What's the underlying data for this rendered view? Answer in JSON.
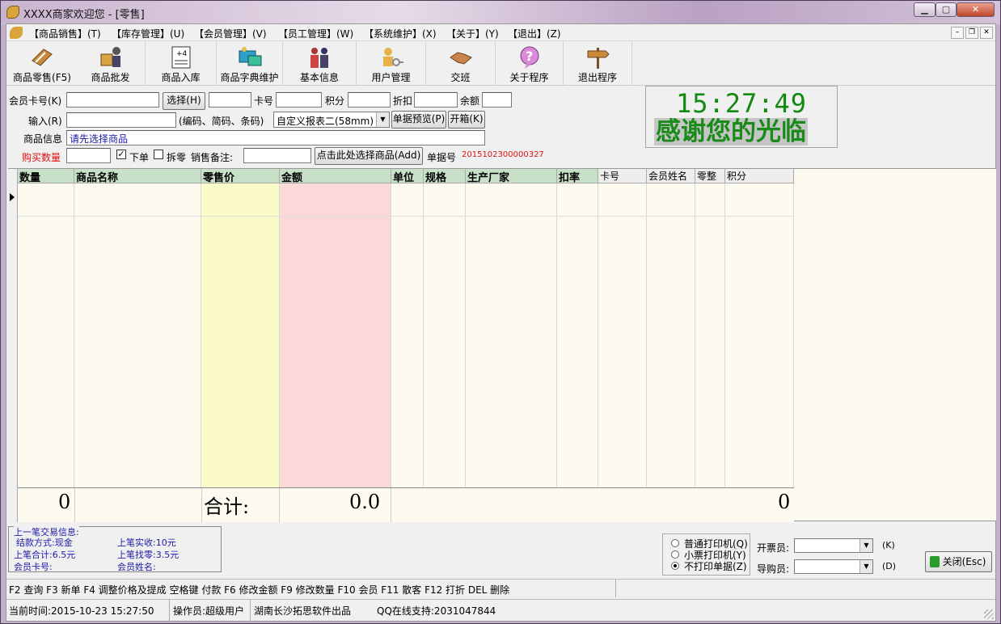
{
  "window": {
    "title": "XXXX商家欢迎您 - [零售]"
  },
  "menu": [
    "【商品销售】(T)",
    "【库存管理】(U)",
    "【会员管理】(V)",
    "【员工管理】(W)",
    "【系统维护】(X)",
    "【关于】(Y)",
    "【退出】(Z)"
  ],
  "toolbar": [
    "商品零售(F5)",
    "商品批发",
    "商品入库",
    "商品字典维护",
    "基本信息",
    "用户管理",
    "交班",
    "关于程序",
    "退出程序"
  ],
  "form": {
    "member_card_label": "会员卡号(K)",
    "select_button": "选择(H)",
    "card_label": "卡号",
    "points_label": "积分",
    "discount_label": "折扣",
    "balance_label": "余额",
    "input_label": "输入(R)",
    "input_hint": "(编码、简码、条码)",
    "report_select": "自定义报表二(58mm)",
    "preview_button": "单据预览(P)",
    "open_box_button": "开箱(K)",
    "goods_info_label": "商品信息",
    "goods_info_value": "请先选择商品",
    "qty_label": "购买数量",
    "order_check_label": "下单",
    "order_checked": true,
    "split_label": "拆零",
    "split_checked": false,
    "remark_label": "销售备注:",
    "choose_goods_button": "点击此处选择商品(Add)",
    "bill_no_label": "单据号",
    "bill_no": "2015102300000327"
  },
  "clock": {
    "time": "15:27:49",
    "message": "感谢您的光临"
  },
  "grid": {
    "columns": [
      "数量",
      "商品名称",
      "零售价",
      "金额",
      "单位",
      "规格",
      "生产厂家",
      "扣率",
      "卡号",
      "会员姓名",
      "零整",
      "积分"
    ],
    "totals": {
      "qty": "0",
      "label": "合计:",
      "amount": "0.0",
      "points": "0"
    }
  },
  "last_trade": {
    "title": "上一笔交易信息:",
    "pay_method": "结款方式:现金",
    "last_total": "上笔合计:6.5元",
    "member_card": "会员卡号:",
    "received": "上笔实收:10元",
    "change": "上笔找零:3.5元",
    "member_name": "会员姓名:"
  },
  "print": {
    "options": [
      "普通打印机(Q)",
      "小票打印机(Y)",
      "不打印单据(Z)"
    ],
    "selected": 2
  },
  "staff": {
    "invoice_label": "开票员:",
    "invoice_key": "(K)",
    "guide_label": "导购员:",
    "guide_key": "(D)",
    "close_button": "关闭(Esc)"
  },
  "shortcuts": "F2 查询 F3 新单 F4 调整价格及提成 空格键 付款 F6 修改金额  F9 修改数量 F10 会员 F11 散客 F12 打折 DEL 删除",
  "status": {
    "time": "当前时间:2015-10-23 15:27:50",
    "operator": "操作员:超级用户",
    "vendor": "湖南长沙拓思软件出品",
    "qq": "QQ在线支持:2031047844"
  },
  "colors": {
    "price_col": "#fbfbc9",
    "amount_col": "#fbd9d9",
    "header_bg": "#c8e0c8",
    "clock_green": "#128a12"
  }
}
